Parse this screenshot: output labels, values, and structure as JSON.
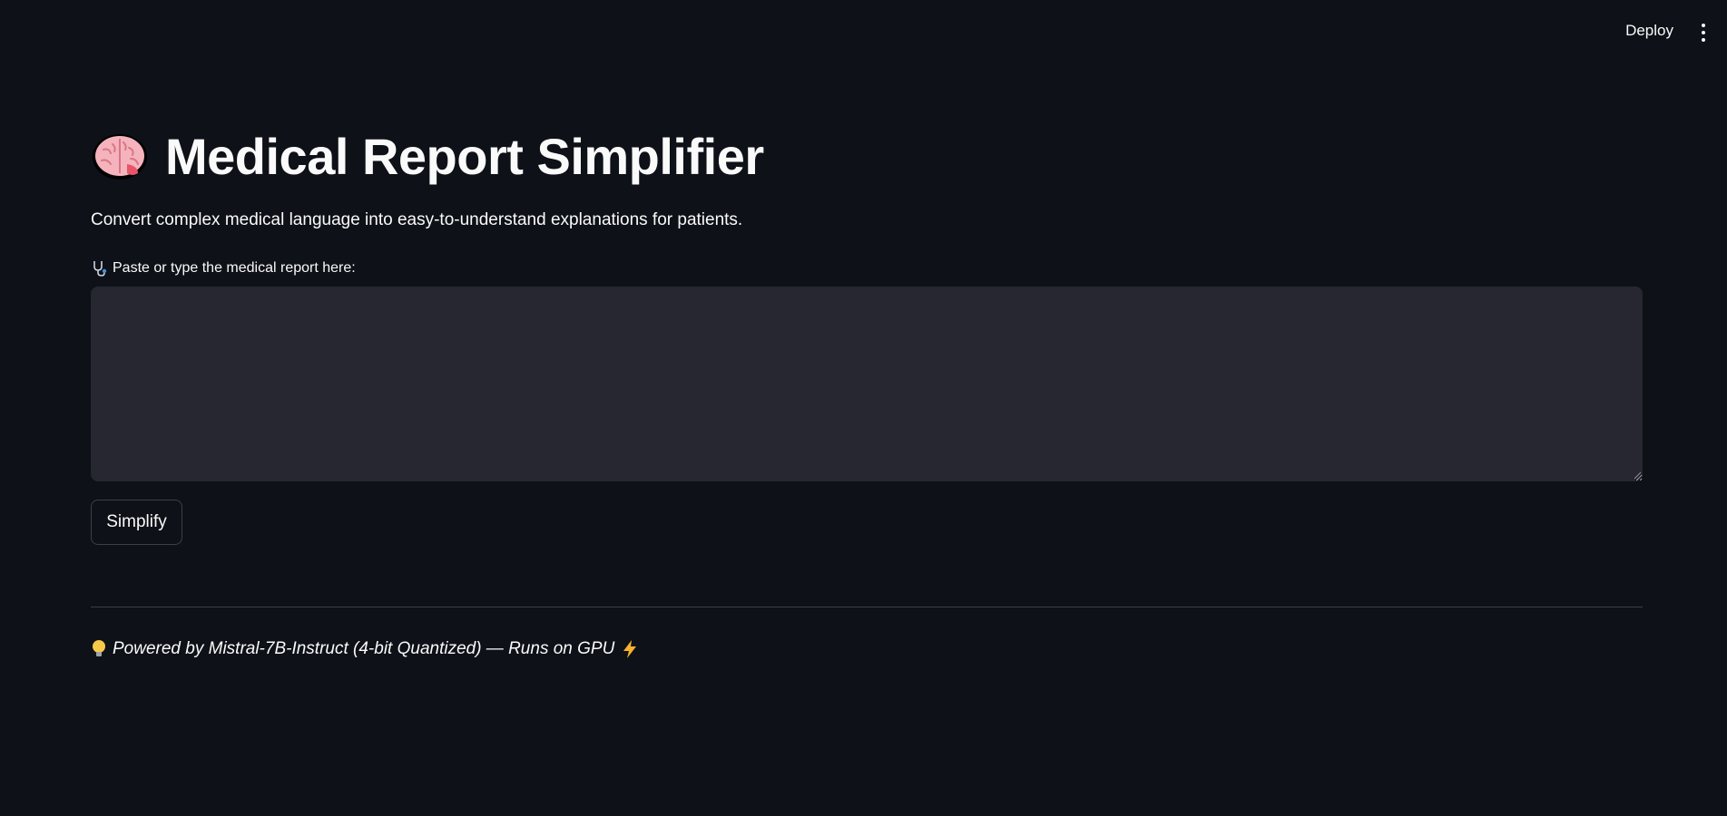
{
  "header": {
    "deploy_label": "Deploy",
    "menu_icon": "kebab-menu-icon"
  },
  "main": {
    "title_icon": "brain-icon",
    "title": "Medical Report Simplifier",
    "subtitle": "Convert complex medical language into easy-to-understand explanations for patients.",
    "input": {
      "label_icon": "stethoscope-icon",
      "label": "Paste or type the medical report here:",
      "value": "",
      "placeholder": ""
    },
    "simplify_label": "Simplify",
    "footer": {
      "lead_icon": "lightbulb-icon",
      "text": "Powered by Mistral-7B-Instruct (4-bit Quantized) — Runs on GPU",
      "trail_icon": "lightning-icon"
    }
  },
  "colors": {
    "background": "#0e1117",
    "input_background": "#262730",
    "text": "#fafafa"
  }
}
